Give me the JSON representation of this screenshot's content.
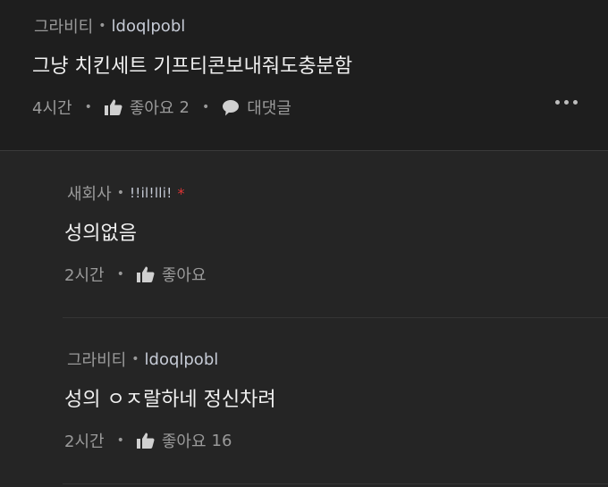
{
  "post": {
    "nickname": "그라비티",
    "user_id": "ldoqlpobl",
    "text": "그냥 치킨세트 기프티콘보내줘도충분함",
    "time": "4시간",
    "like_label": "좋아요",
    "like_count": "2",
    "reply_label": "대댓글"
  },
  "replies": [
    {
      "nickname": "새회사",
      "user_id": "!!il!lli!",
      "mark": "*",
      "text": "성의없음",
      "time": "2시간",
      "like_label": "좋아요",
      "like_count": ""
    },
    {
      "nickname": "그라비티",
      "user_id": "ldoqlpobl",
      "text": "성의 ㅇㅈ랄하네 정신차려",
      "time": "2시간",
      "like_label": "좋아요",
      "like_count": "16"
    }
  ],
  "icons": {
    "like": "thumbs-up-icon",
    "reply": "speech-bubble-icon",
    "more": "more-dots-icon"
  },
  "colors": {
    "background": "#1e1e1e",
    "reply_background": "#252525",
    "user_id": "#c6cbd6",
    "mark": "#e03535"
  }
}
